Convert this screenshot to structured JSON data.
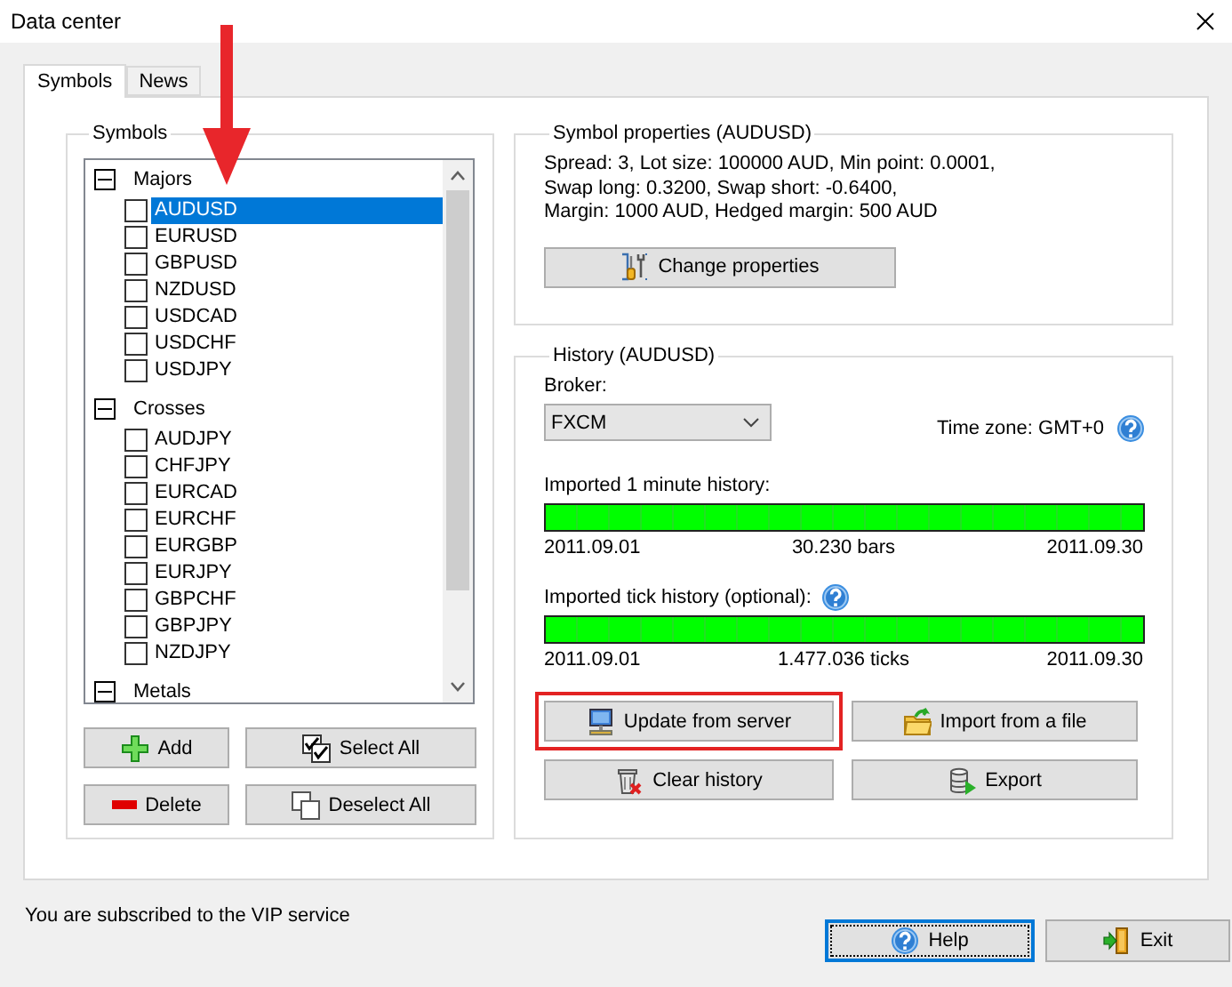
{
  "window": {
    "title": "Data center"
  },
  "tabs": [
    {
      "label": "Symbols",
      "selected": true
    },
    {
      "label": "News",
      "selected": false
    }
  ],
  "symbols_group": {
    "title": "Symbols",
    "tree": [
      {
        "label": "Majors",
        "expanded": true,
        "items": [
          {
            "label": "AUDUSD",
            "checked": false,
            "selected": true
          },
          {
            "label": "EURUSD",
            "checked": false,
            "selected": false
          },
          {
            "label": "GBPUSD",
            "checked": false,
            "selected": false
          },
          {
            "label": "NZDUSD",
            "checked": false,
            "selected": false
          },
          {
            "label": "USDCAD",
            "checked": false,
            "selected": false
          },
          {
            "label": "USDCHF",
            "checked": false,
            "selected": false
          },
          {
            "label": "USDJPY",
            "checked": false,
            "selected": false
          }
        ]
      },
      {
        "label": "Crosses",
        "expanded": true,
        "items": [
          {
            "label": "AUDJPY",
            "checked": false,
            "selected": false
          },
          {
            "label": "CHFJPY",
            "checked": false,
            "selected": false
          },
          {
            "label": "EURCAD",
            "checked": false,
            "selected": false
          },
          {
            "label": "EURCHF",
            "checked": false,
            "selected": false
          },
          {
            "label": "EURGBP",
            "checked": false,
            "selected": false
          },
          {
            "label": "EURJPY",
            "checked": false,
            "selected": false
          },
          {
            "label": "GBPCHF",
            "checked": false,
            "selected": false
          },
          {
            "label": "GBPJPY",
            "checked": false,
            "selected": false
          },
          {
            "label": "NZDJPY",
            "checked": false,
            "selected": false
          }
        ]
      },
      {
        "label": "Metals",
        "expanded": true
      }
    ],
    "buttons": [
      {
        "label": "Add",
        "kind": "plus"
      },
      {
        "label": "Select All",
        "kind": "select-all"
      },
      {
        "label": "Delete",
        "kind": "minus"
      },
      {
        "label": "Deselect All",
        "kind": "deselect"
      }
    ]
  },
  "symbol_properties": {
    "title": "Symbol properties (AUDUSD)",
    "lines": [
      "Spread: 3, Lot size: 100000 AUD, Min point: 0.0001,",
      "Swap long: 0.3200, Swap short: -0.6400,",
      "Margin: 1000 AUD, Hedged margin: 500 AUD"
    ],
    "button": {
      "label": "Change properties",
      "kind": "tools"
    }
  },
  "history": {
    "title": "History (AUDUSD)",
    "broker_label": "Broker:",
    "broker": {
      "value": "FXCM"
    },
    "time_zone": "Time zone: GMT+0",
    "imports": [
      {
        "label": "Imported 1 minute history:",
        "help": false,
        "level": 1,
        "start": "2011.09.01",
        "count": "30.230 bars",
        "end": "2011.09.30"
      },
      {
        "label": "Imported tick history (optional):",
        "help": true,
        "level": 1,
        "start": "2011.09.01",
        "count": "1.477.036 ticks",
        "end": "2011.09.30"
      }
    ],
    "buttons": [
      {
        "label": "Update from server",
        "kind": "computer",
        "highlighted": true
      },
      {
        "label": "Import from a file",
        "kind": "folder",
        "highlighted": false
      },
      {
        "label": "Clear history",
        "kind": "trash",
        "highlighted": false
      },
      {
        "label": "Export",
        "kind": "database",
        "highlighted": false
      }
    ]
  },
  "status": "You are subscribed to the VIP service",
  "footer_buttons": [
    {
      "label": "Help",
      "kind": "help",
      "focused": true
    },
    {
      "label": "Exit",
      "kind": "door",
      "focused": false
    }
  ],
  "annotation_arrow": true
}
